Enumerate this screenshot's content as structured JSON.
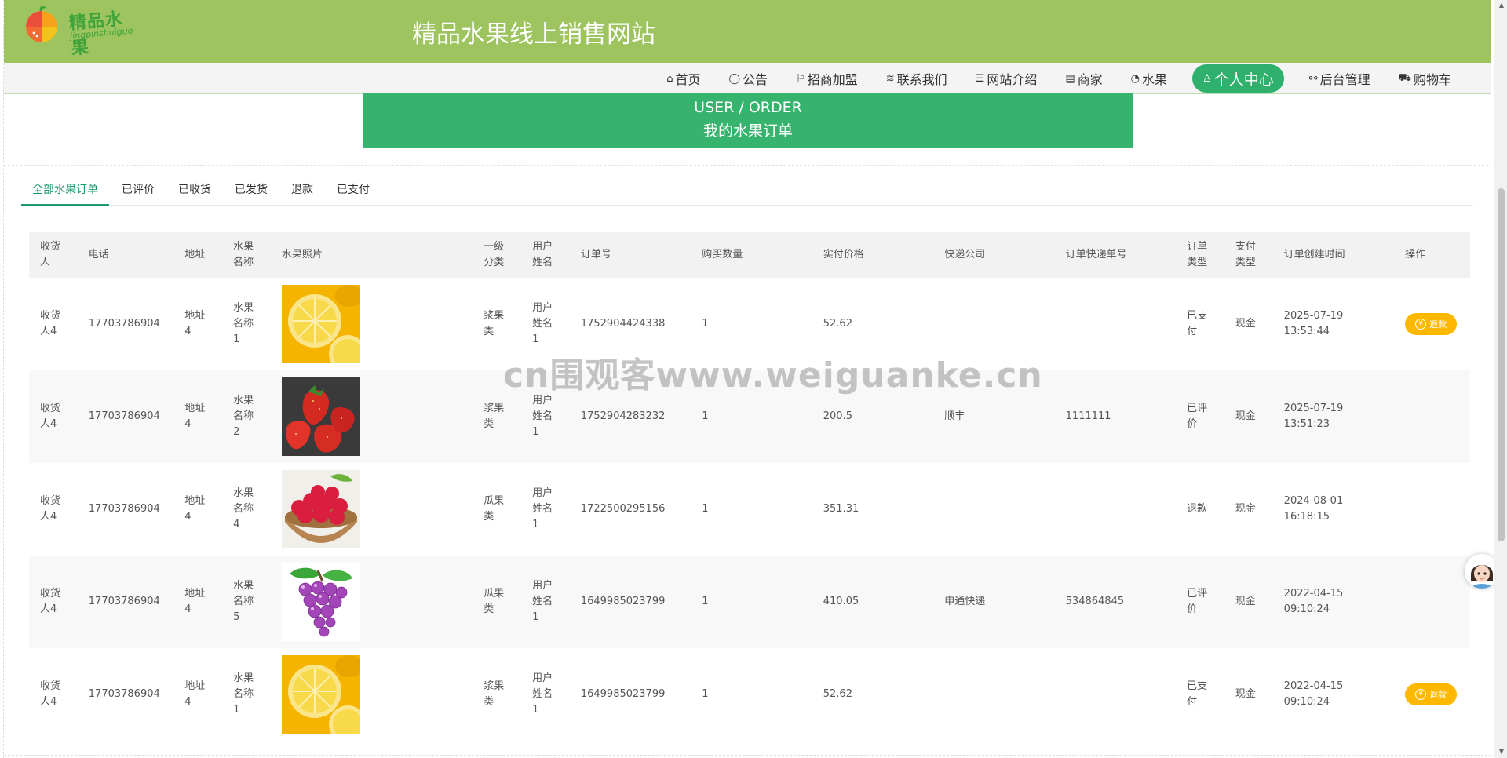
{
  "header": {
    "logo_text": "精品水果",
    "logo_sub": "jingpinshuiguo",
    "site_title": "精品水果线上销售网站"
  },
  "nav": [
    {
      "icon": "home-icon",
      "glyph": "⌂",
      "label": "首页"
    },
    {
      "icon": "notice-icon",
      "glyph": "◯",
      "label": "公告"
    },
    {
      "icon": "flag-icon",
      "glyph": "⚐",
      "label": "招商加盟"
    },
    {
      "icon": "layers-icon",
      "glyph": "≋",
      "label": "联系我们"
    },
    {
      "icon": "sliders-icon",
      "glyph": "☰",
      "label": "网站介绍"
    },
    {
      "icon": "document-icon",
      "glyph": "▤",
      "label": "商家"
    },
    {
      "icon": "gauge-icon",
      "glyph": "◔",
      "label": "水果"
    },
    {
      "icon": "user-icon",
      "glyph": "♙",
      "label": "个人中心"
    },
    {
      "icon": "link-icon",
      "glyph": "⚯",
      "label": "后台管理"
    },
    {
      "icon": "cart-icon",
      "glyph": "⛟",
      "label": "购物车"
    }
  ],
  "banner": {
    "en": "USER / ORDER",
    "cn": "我的水果订单"
  },
  "tabs": [
    "全部水果订单",
    "已评价",
    "已收货",
    "已发货",
    "退款",
    "已支付"
  ],
  "table": {
    "headers": [
      "收货人",
      "电话",
      "地址",
      "水果名称",
      "水果照片",
      "一级分类",
      "用户姓名",
      "订单号",
      "购买数量",
      "实付价格",
      "快递公司",
      "订单快递单号",
      "订单类型",
      "支付类型",
      "订单创建时间",
      "操作"
    ],
    "rows": [
      {
        "receiver": "收货人4",
        "phone": "17703786904",
        "address": "地址4",
        "fruit": "水果名称1",
        "photo": "lemon",
        "category": "浆果类",
        "user": "用户姓名1",
        "order_no": "1752904424338",
        "qty": "1",
        "price": "52.62",
        "courier": "",
        "tracking": "",
        "status": "已支付",
        "pay": "现金",
        "created_date": "2025-07-19",
        "created_time": "13:53:44",
        "action": "退款"
      },
      {
        "receiver": "收货人4",
        "phone": "17703786904",
        "address": "地址4",
        "fruit": "水果名称2",
        "photo": "strawberry",
        "category": "浆果类",
        "user": "用户姓名1",
        "order_no": "1752904283232",
        "qty": "1",
        "price": "200.5",
        "courier": "顺丰",
        "tracking": "1111111",
        "status": "已评价",
        "pay": "现金",
        "created_date": "2025-07-19",
        "created_time": "13:51:23",
        "action": ""
      },
      {
        "receiver": "收货人4",
        "phone": "17703786904",
        "address": "地址4",
        "fruit": "水果名称4",
        "photo": "raspberry",
        "category": "瓜果类",
        "user": "用户姓名1",
        "order_no": "1722500295156",
        "qty": "1",
        "price": "351.31",
        "courier": "",
        "tracking": "",
        "status": "退款",
        "pay": "现金",
        "created_date": "2024-08-01",
        "created_time": "16:18:15",
        "action": ""
      },
      {
        "receiver": "收货人4",
        "phone": "17703786904",
        "address": "地址4",
        "fruit": "水果名称5",
        "photo": "grape",
        "category": "瓜果类",
        "user": "用户姓名1",
        "order_no": "1649985023799",
        "qty": "1",
        "price": "410.05",
        "courier": "申通快递",
        "tracking": "534864845",
        "status": "已评价",
        "pay": "现金",
        "created_date": "2022-04-15",
        "created_time": "09:10:24",
        "action": ""
      },
      {
        "receiver": "收货人4",
        "phone": "17703786904",
        "address": "地址4",
        "fruit": "水果名称1",
        "photo": "lemon",
        "category": "浆果类",
        "user": "用户姓名1",
        "order_no": "1649985023799",
        "qty": "1",
        "price": "52.62",
        "courier": "",
        "tracking": "",
        "status": "已支付",
        "pay": "现金",
        "created_date": "2022-04-15",
        "created_time": "09:10:24",
        "action": "退款"
      }
    ]
  },
  "watermark": "cn围观客www.weiguanke.cn",
  "colors": {
    "header": "#9dc45f",
    "accent": "#36b46e",
    "tab_active": "#1a9a6a",
    "refund": "#ffb800"
  }
}
